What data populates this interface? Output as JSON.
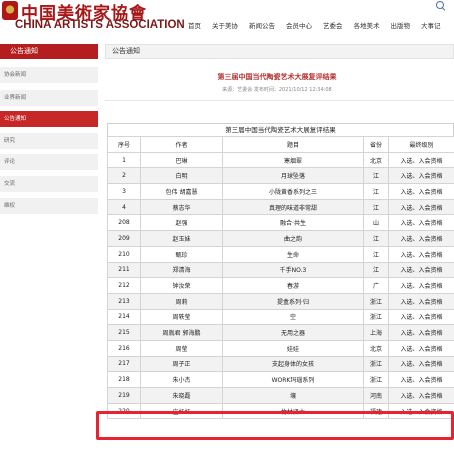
{
  "header": {
    "logo_cn": "中国美術家協會",
    "logo_en": "CHINA ARTISTS ASSOCIATION",
    "nav": [
      "首页",
      "关于美协",
      "新闻公告",
      "会员中心",
      "艺委会",
      "各地美术",
      "出版物",
      "大事记"
    ]
  },
  "sidebar": {
    "title": "公告通知",
    "items": [
      "协会新闻",
      "业界新闻",
      "公告通知",
      "研究",
      "评论",
      "交流",
      "维权"
    ],
    "active_index": 2
  },
  "main": {
    "tab_label": "公告通知",
    "article_title": "第三届中国当代陶瓷艺术大展复评结果",
    "article_meta": "来源：艺委会 发布时间：2021/10/12 12:34:08",
    "table": {
      "caption": "第三届中国当代陶瓷艺术大展复评结果",
      "headers": [
        "序号",
        "作者",
        "题目",
        "省份",
        "最终级别"
      ],
      "rows": [
        [
          "1",
          "巴琳",
          "寒烟翠",
          "北京",
          "入选、入会资格"
        ],
        [
          "2",
          "白明",
          "月球坠落",
          "江",
          "入选、入会资格"
        ],
        [
          "3",
          "包伟 胡嘉慧",
          "小陇黄香系列之三",
          "江",
          "入选、入会资格"
        ],
        [
          "4",
          "蔡志华",
          "真理的味道非常甜",
          "江",
          "入选、入会资格"
        ],
        [
          "208",
          "赵强",
          "融合·共生",
          "山",
          "入选、入会资格"
        ],
        [
          "209",
          "赵玉妹",
          "曲之韵",
          "江",
          "入选、入会资格"
        ],
        [
          "210",
          "甄珍",
          "生命",
          "江",
          "入选、入会资格"
        ],
        [
          "211",
          "郑清海",
          "千手NO.3",
          "江",
          "入选、入会资格"
        ],
        [
          "212",
          "钟汝荣",
          "春游",
          "广",
          "入选、入会资格"
        ],
        [
          "213",
          "周莉",
          "提盒系列·归",
          "浙江",
          "入选、入会资格"
        ],
        [
          "214",
          "周轶莹",
          "空",
          "浙江",
          "入选、入会资格"
        ],
        [
          "215",
          "周胤君 郭海鹏",
          "无用之器",
          "上海",
          "入选、入会资格"
        ],
        [
          "216",
          "周莹",
          "娃娃",
          "北京",
          "入选、入会资格"
        ],
        [
          "217",
          "周子正",
          "支起身体的女孩",
          "浙江",
          "入选、入会资格"
        ],
        [
          "218",
          "朱小杰",
          "WORK玛瑙系列",
          "浙江",
          "入选、入会资格"
        ],
        [
          "219",
          "朱晓磊",
          "壤",
          "河南",
          "入选、入会资格"
        ],
        [
          "220",
          "庄虹虹",
          "竹林贤士",
          "福建",
          "入选、入会资格"
        ]
      ]
    }
  },
  "colors": {
    "brand_red": "#b51e1e",
    "highlight": "#e8232f",
    "title_red": "#b43333"
  },
  "icons": [
    "search-icon"
  ]
}
